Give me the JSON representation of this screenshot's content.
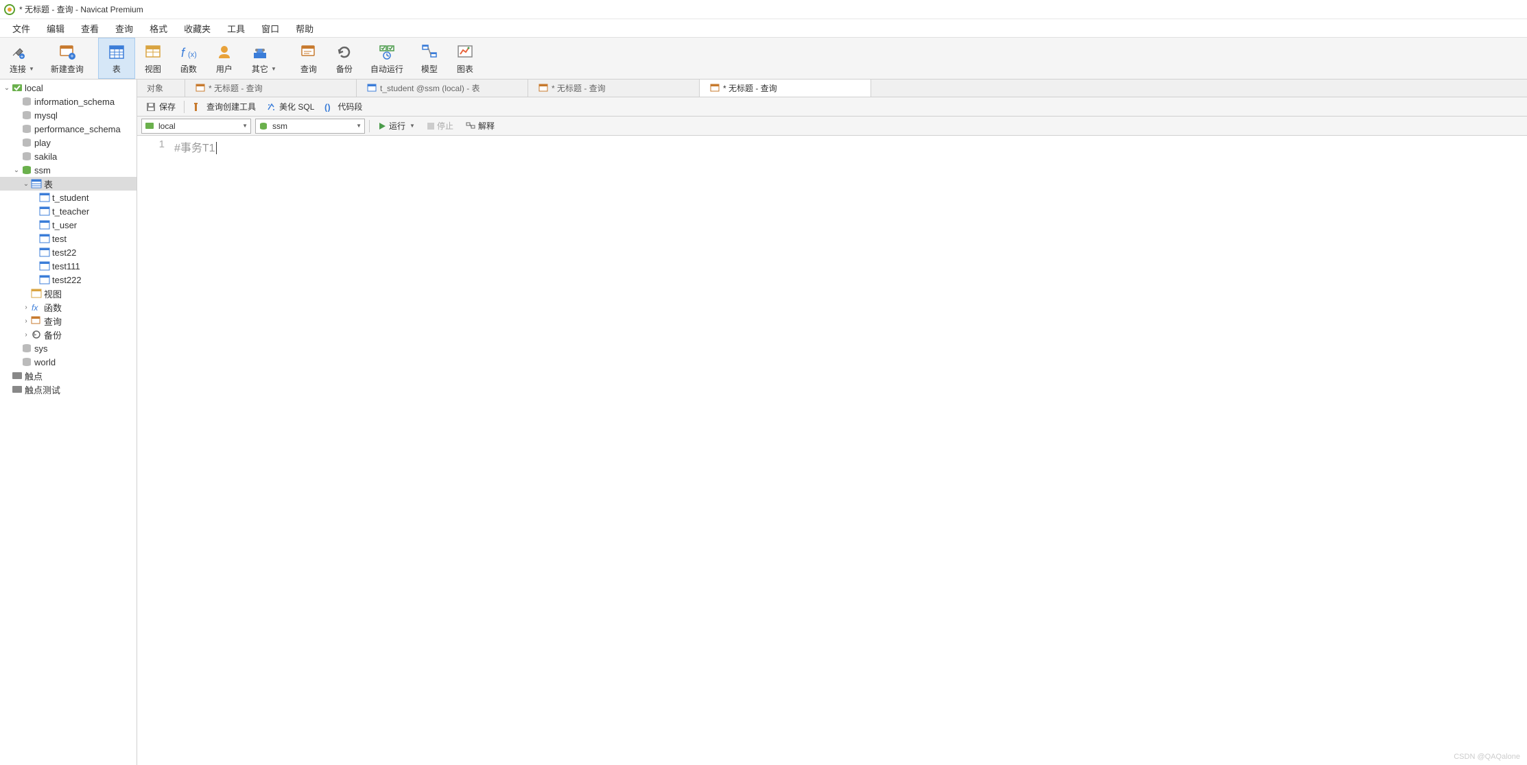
{
  "window": {
    "title": "* 无标题 - 查询 - Navicat Premium"
  },
  "menu": {
    "items": [
      "文件",
      "编辑",
      "查看",
      "查询",
      "格式",
      "收藏夹",
      "工具",
      "窗口",
      "帮助"
    ]
  },
  "toolbar": {
    "connect": "连接",
    "newquery": "新建查询",
    "table": "表",
    "view": "视图",
    "function": "函数",
    "user": "用户",
    "other": "其它",
    "query": "查询",
    "backup": "备份",
    "autorun": "自动运行",
    "model": "模型",
    "chart": "图表"
  },
  "tree": {
    "root": "local",
    "dbs": [
      "information_schema",
      "mysql",
      "performance_schema",
      "play",
      "sakila"
    ],
    "ssm": "ssm",
    "tables_label": "表",
    "tables": [
      "t_student",
      "t_teacher",
      "t_user",
      "test",
      "test22",
      "test111",
      "test222"
    ],
    "views": "视图",
    "functions": "函数",
    "queries": "查询",
    "backups": "备份",
    "sys": "sys",
    "world": "world",
    "touch1": "触点",
    "touch2": "触点测试"
  },
  "tabs": {
    "objects": "对象",
    "tab1": "* 无标题 - 查询",
    "tab2": "t_student @ssm (local) - 表",
    "tab3": "* 无标题 - 查询",
    "tab4": "* 无标题 - 查询"
  },
  "subtoolbar": {
    "save": "保存",
    "builder": "查询创建工具",
    "beautify": "美化 SQL",
    "snippet": "代码段"
  },
  "runbar": {
    "conn": "local",
    "db": "ssm",
    "run": "运行",
    "stop": "停止",
    "explain": "解释"
  },
  "editor": {
    "line1_no": "1",
    "line1_text": "#事务T1"
  },
  "watermark": "CSDN @QAQalone"
}
